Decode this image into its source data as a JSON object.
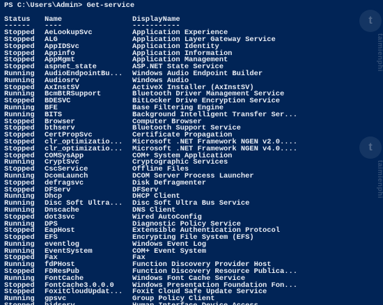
{
  "console": {
    "prompt": "PS C:\\Users\\Admin> Get-service",
    "headers": {
      "status": "Status",
      "name": "Name",
      "display": "DisplayName"
    },
    "separators": {
      "status": "------",
      "name": "----",
      "display": "-----------"
    },
    "rows": [
      {
        "status": "Stopped",
        "name": "AeLookupSvc",
        "display": "Application Experience"
      },
      {
        "status": "Stopped",
        "name": "ALG",
        "display": "Application Layer Gateway Service"
      },
      {
        "status": "Stopped",
        "name": "AppIDSvc",
        "display": "Application Identity"
      },
      {
        "status": "Stopped",
        "name": "Appinfo",
        "display": "Application Information"
      },
      {
        "status": "Stopped",
        "name": "AppMgmt",
        "display": "Application Management"
      },
      {
        "status": "Stopped",
        "name": "aspnet_state",
        "display": "ASP.NET State Service"
      },
      {
        "status": "Running",
        "name": "AudioEndpointBu...",
        "display": "Windows Audio Endpoint Builder"
      },
      {
        "status": "Running",
        "name": "Audiosrv",
        "display": "Windows Audio"
      },
      {
        "status": "Stopped",
        "name": "AxInstSV",
        "display": "ActiveX Installer (AxInstSV)"
      },
      {
        "status": "Running",
        "name": "BcmBtRSupport",
        "display": "Bluetooth Driver Management Service"
      },
      {
        "status": "Stopped",
        "name": "BDESVC",
        "display": "BitLocker Drive Encryption Service"
      },
      {
        "status": "Running",
        "name": "BFE",
        "display": "Base Filtering Engine"
      },
      {
        "status": "Running",
        "name": "BITS",
        "display": "Background Intelligent Transfer Ser..."
      },
      {
        "status": "Stopped",
        "name": "Browser",
        "display": "Computer Browser"
      },
      {
        "status": "Stopped",
        "name": "bthserv",
        "display": "Bluetooth Support Service"
      },
      {
        "status": "Stopped",
        "name": "CertPropSvc",
        "display": "Certificate Propagation"
      },
      {
        "status": "Stopped",
        "name": "clr_optimizatio...",
        "display": "Microsoft .NET Framework NGEN v2.0...."
      },
      {
        "status": "Stopped",
        "name": "clr_optimizatio...",
        "display": "Microsoft .NET Framework NGEN v4.0...."
      },
      {
        "status": "Stopped",
        "name": "COMSysApp",
        "display": "COM+ System Application"
      },
      {
        "status": "Running",
        "name": "CryptSvc",
        "display": "Cryptographic Services"
      },
      {
        "status": "Stopped",
        "name": "CscService",
        "display": "Offline Files"
      },
      {
        "status": "Running",
        "name": "DcomLaunch",
        "display": "DCOM Server Process Launcher"
      },
      {
        "status": "Stopped",
        "name": "defragsvc",
        "display": "Disk Defragmenter"
      },
      {
        "status": "Stopped",
        "name": "DFServ",
        "display": "DFServ"
      },
      {
        "status": "Running",
        "name": "Dhcp",
        "display": "DHCP Client"
      },
      {
        "status": "Running",
        "name": "Disc Soft Ultra...",
        "display": "Disc Soft Ultra Bus Service"
      },
      {
        "status": "Running",
        "name": "Dnscache",
        "display": "DNS Client"
      },
      {
        "status": "Stopped",
        "name": "dot3svc",
        "display": "Wired AutoConfig"
      },
      {
        "status": "Running",
        "name": "DPS",
        "display": "Diagnostic Policy Service"
      },
      {
        "status": "Stopped",
        "name": "EapHost",
        "display": "Extensible Authentication Protocol"
      },
      {
        "status": "Stopped",
        "name": "EFS",
        "display": "Encrypting File System (EFS)"
      },
      {
        "status": "Running",
        "name": "eventlog",
        "display": "Windows Event Log"
      },
      {
        "status": "Running",
        "name": "EventSystem",
        "display": "COM+ Event System"
      },
      {
        "status": "Stopped",
        "name": "Fax",
        "display": "Fax"
      },
      {
        "status": "Running",
        "name": "fdPHost",
        "display": "Function Discovery Provider Host"
      },
      {
        "status": "Stopped",
        "name": "FDResPub",
        "display": "Function Discovery Resource Publica..."
      },
      {
        "status": "Running",
        "name": "FontCache",
        "display": "Windows Font Cache Service"
      },
      {
        "status": "Stopped",
        "name": "FontCache3.0.0.0",
        "display": "Windows Presentation Foundation Fon..."
      },
      {
        "status": "Stopped",
        "name": "FoxitCloudUpdat...",
        "display": "Foxit Cloud Safe Update Service"
      },
      {
        "status": "Running",
        "name": "gpsvc",
        "display": "Group Policy Client"
      },
      {
        "status": "Stopped",
        "name": "hidserv",
        "display": "Human Interface Device Access"
      }
    ]
  }
}
